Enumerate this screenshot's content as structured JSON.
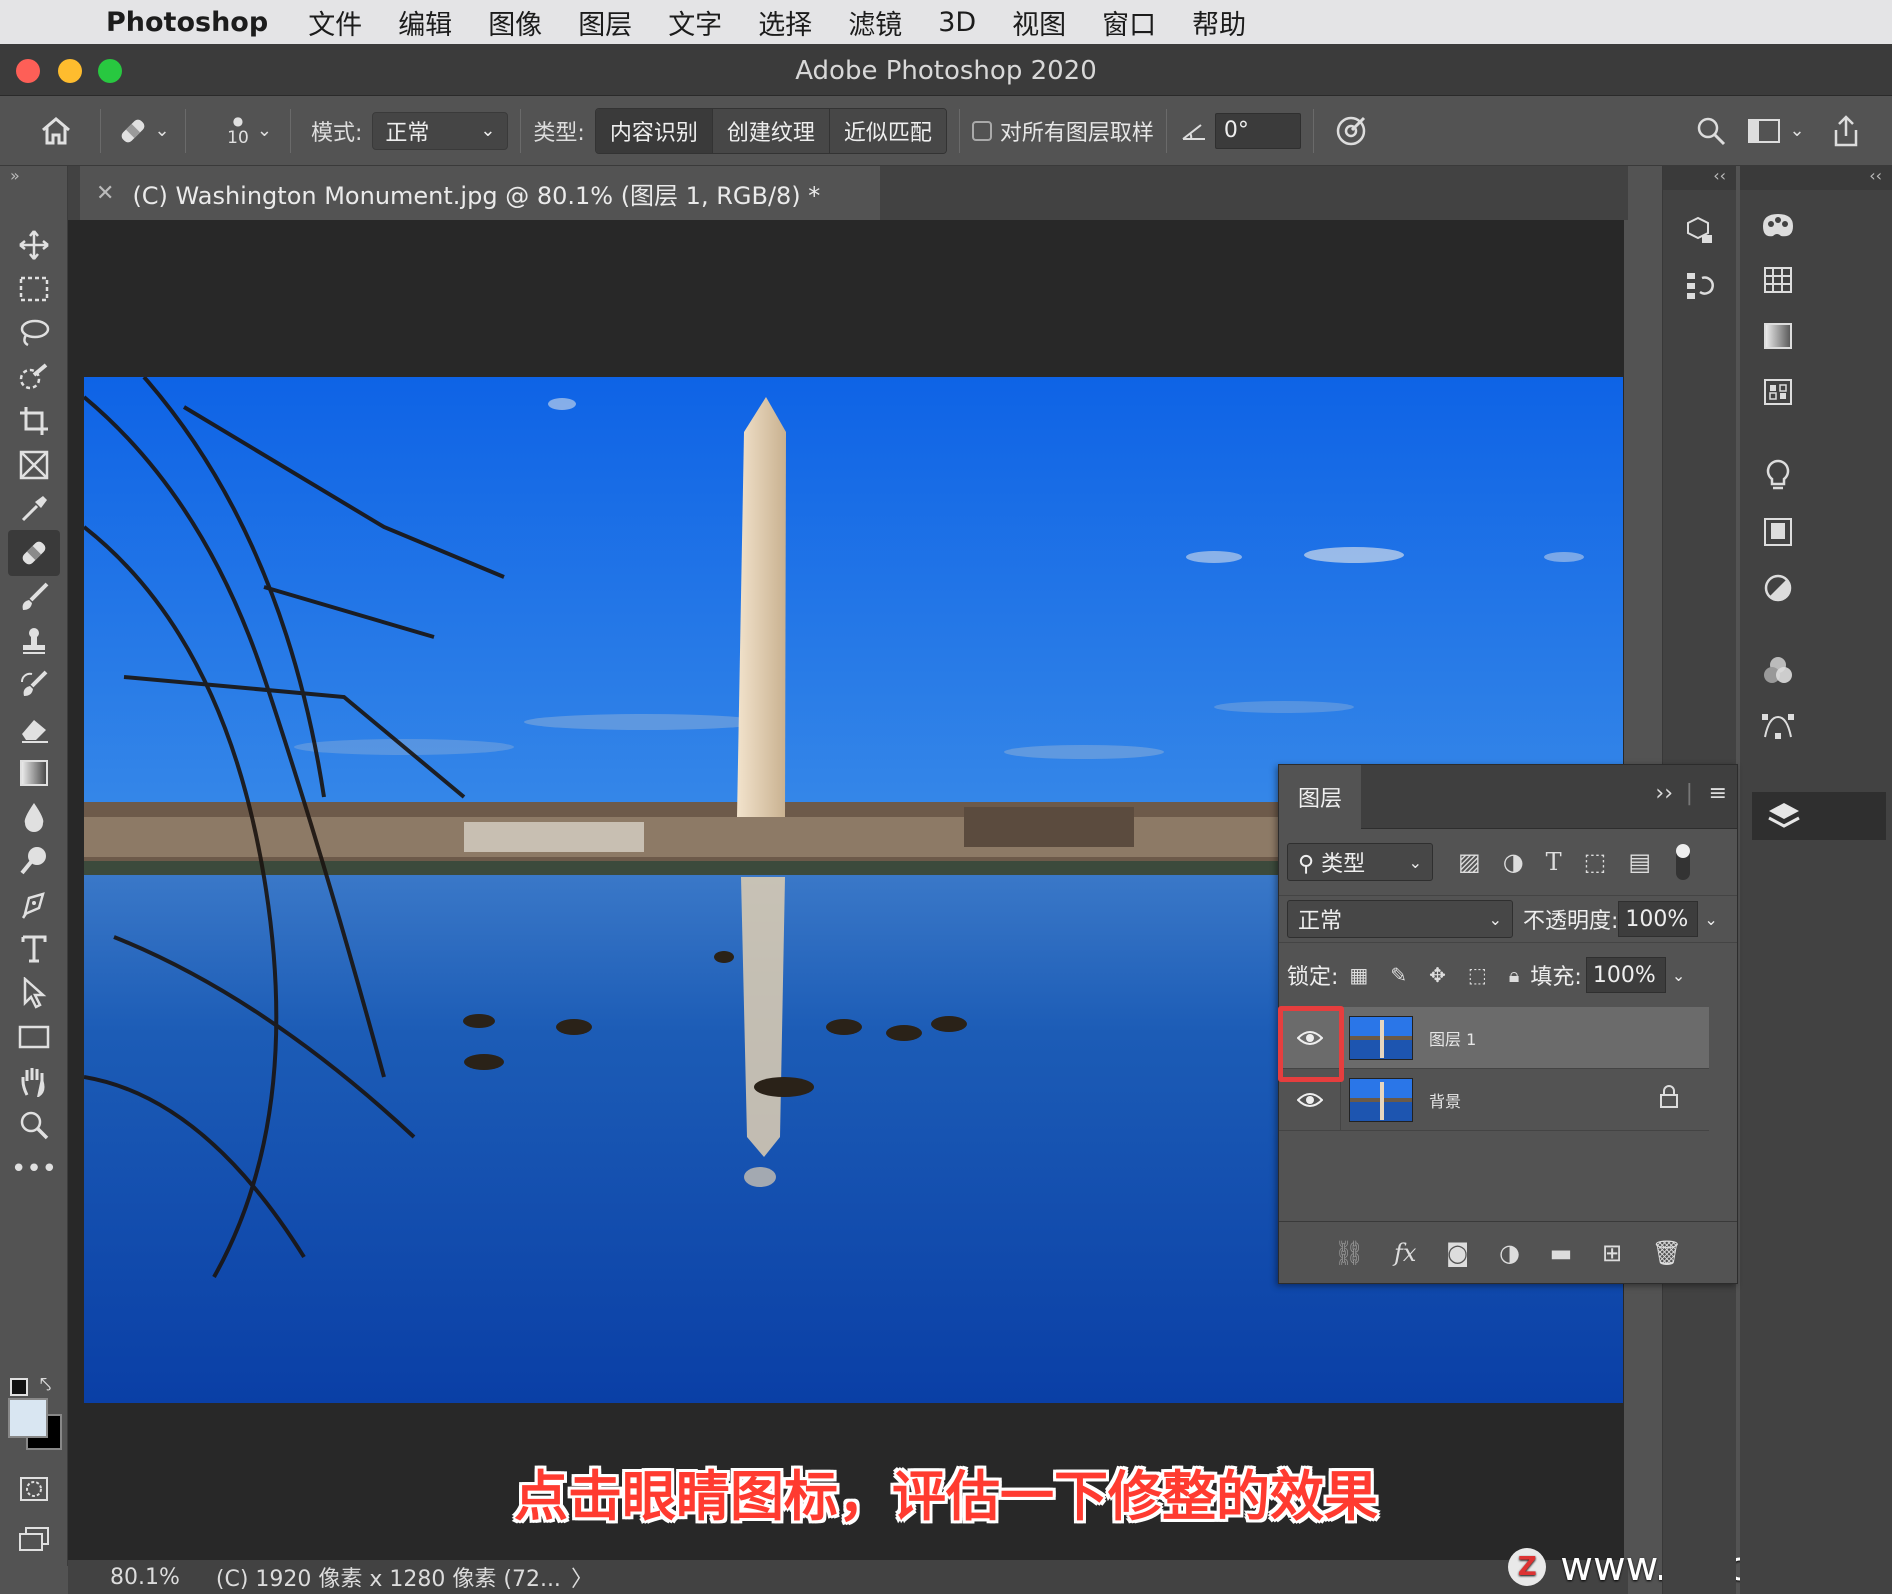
{
  "menubar": {
    "app_name": "Photoshop",
    "items": [
      "文件",
      "编辑",
      "图像",
      "图层",
      "文字",
      "选择",
      "滤镜",
      "3D",
      "视图",
      "窗口",
      "帮助"
    ]
  },
  "window": {
    "title": "Adobe Photoshop 2020"
  },
  "options_bar": {
    "brush_size": "10",
    "mode_label": "模式:",
    "mode_value": "正常",
    "type_label": "类型:",
    "type_options": [
      "内容识别",
      "创建纹理",
      "近似匹配"
    ],
    "sample_all_label": "对所有图层取样",
    "angle_value": "0°"
  },
  "document": {
    "tab_title": "(C) Washington Monument.jpg @ 80.1% (图层 1, RGB/8) *"
  },
  "status_bar": {
    "zoom": "80.1%",
    "info": "(C) 1920 像素 x 1280 像素 (72...",
    "arrow": "〉"
  },
  "layers_panel": {
    "tab_label": "图层",
    "filter_kind": "类型",
    "blend_mode": "正常",
    "opacity_label": "不透明度:",
    "opacity_value": "100%",
    "lock_label": "锁定:",
    "fill_label": "填充:",
    "fill_value": "100%",
    "layers": [
      {
        "name": "图层 1",
        "selected": true,
        "locked": false
      },
      {
        "name": "背景",
        "selected": false,
        "locked": true
      }
    ]
  },
  "caption": "点击眼睛图标，评估一下修整的效果",
  "watermark": {
    "logo": "Z",
    "text": "www.MacZ.com"
  },
  "colors": {
    "highlight": "#e63e3e",
    "caption": "#ff3b30",
    "sky": "#1f6fe0",
    "water": "#1450a8"
  }
}
